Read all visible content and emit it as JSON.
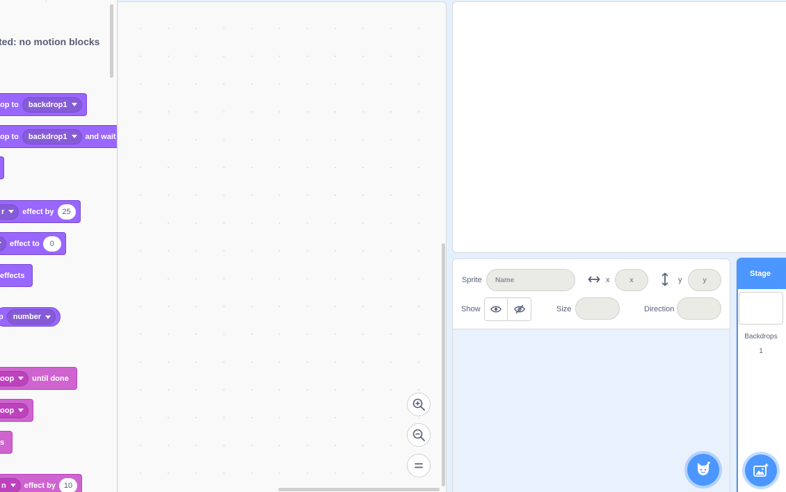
{
  "palette": {
    "note": "ted: no motion blocks",
    "blocks": {
      "switch_backdrop": {
        "prefix": "op to",
        "menu": "backdrop1"
      },
      "switch_backdrop_wait": {
        "prefix": "op to",
        "menu": "backdrop1",
        "suffix": "and wait"
      },
      "change_effect": {
        "prefix": "r",
        "mid": "effect by",
        "value": "25"
      },
      "set_effect": {
        "mid": "effect to",
        "value": "0"
      },
      "clear_effects": {
        "text": "effects"
      },
      "backdrop_reporter": {
        "prefix": "p",
        "menu": "number"
      },
      "play_sound_until_done": {
        "menu": "oop",
        "suffix": "until done"
      },
      "start_sound": {
        "menu": "oop"
      },
      "stop_sounds": {
        "text": "s"
      },
      "change_sound_effect": {
        "prefix": "n",
        "mid": "effect by",
        "value": "10"
      }
    }
  },
  "sprite_info": {
    "sprite_label": "Sprite",
    "name_placeholder": "Name",
    "x_label": "x",
    "x_placeholder": "x",
    "y_label": "y",
    "y_placeholder": "y",
    "show_label": "Show",
    "size_label": "Size",
    "direction_label": "Direction"
  },
  "stage_selector": {
    "header": "Stage",
    "backdrops_label": "Backdrops",
    "backdrops_count": "1"
  },
  "colors": {
    "looks": "#9966ff",
    "sound": "#cf63cf",
    "accent": "#4c97ff"
  }
}
